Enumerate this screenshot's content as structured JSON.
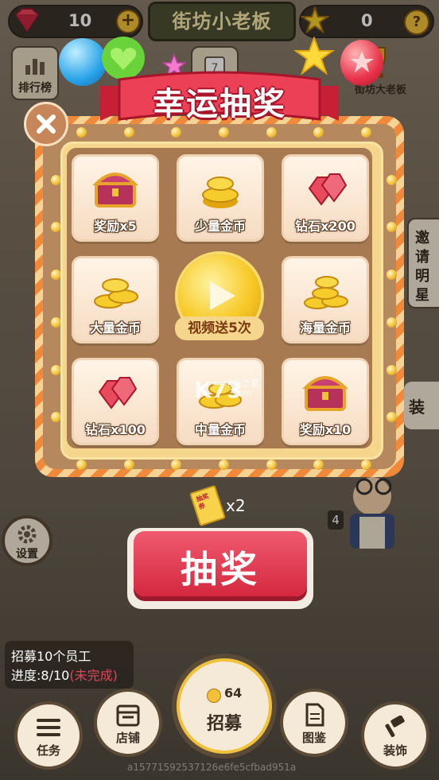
{
  "topbar": {
    "gems": "10",
    "title": "街坊小老板",
    "stars": "0",
    "help": "?"
  },
  "side": {
    "leaderboard": "排行榜",
    "boss_label": "街坊大老板",
    "invite_star": "邀请明星",
    "decor_tab": "装",
    "settings": "设置",
    "worker_count": "4"
  },
  "lottery": {
    "title": "幸运抽奖",
    "cells": [
      {
        "label": "奖励x5",
        "icon": "treasure-chest"
      },
      {
        "label": "少量金币",
        "icon": "coins-small"
      },
      {
        "label": "钻石x200",
        "icon": "diamonds"
      },
      {
        "label": "大量金币",
        "icon": "coins-large"
      },
      {
        "label": "视频送5次",
        "icon": "play"
      },
      {
        "label": "海量金币",
        "icon": "coins-huge"
      },
      {
        "label": "钻石x100",
        "icon": "diamonds"
      },
      {
        "label": "中量金币",
        "icon": "coins-medium"
      },
      {
        "label": "奖励x10",
        "icon": "treasure-chest"
      }
    ],
    "ticket_label": "抽奖券",
    "ticket_count": "x2",
    "draw_button": "抽奖",
    "watermark_brand": "K73",
    "watermark_site": "电玩之家",
    "watermark_url": ".com"
  },
  "task": {
    "line1": "招募10个员工",
    "progress_prefix": "进度:8/10",
    "progress_status": "(未完成)"
  },
  "bottom": {
    "tasks": "任务",
    "shop": "店铺",
    "recruit_cost": "64",
    "recruit": "招募",
    "catalog": "图鉴",
    "decorate": "装饰"
  },
  "footer_id": "a15771592537126e6fe5cfbad951a",
  "colors": {
    "accent_red": "#d4283f",
    "panel_orange": "#f08a3a",
    "gold": "#f2c13a"
  }
}
